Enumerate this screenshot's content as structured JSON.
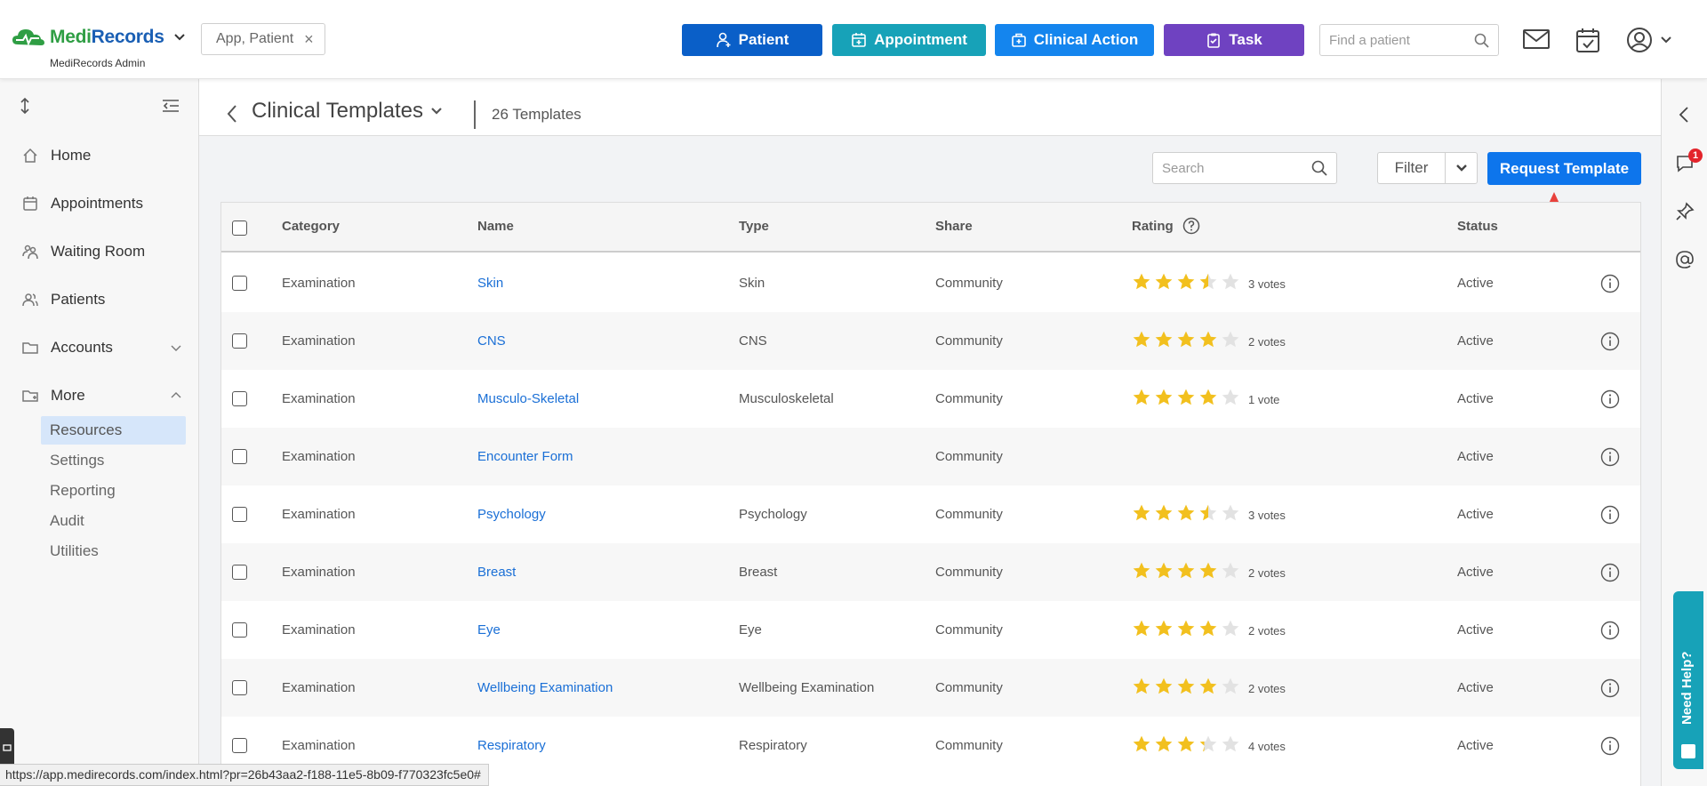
{
  "app": {
    "name_part1": "Medi",
    "name_part2": "Records",
    "subtitle": "MediRecords Admin",
    "context_chip": "App, Patient"
  },
  "header": {
    "buttons": {
      "patient": "Patient",
      "appointment": "Appointment",
      "clinical_action": "Clinical Action",
      "task": "Task"
    },
    "find_placeholder": "Find a patient"
  },
  "sidebar": {
    "items": [
      {
        "label": "Home"
      },
      {
        "label": "Appointments"
      },
      {
        "label": "Waiting Room"
      },
      {
        "label": "Patients"
      },
      {
        "label": "Accounts"
      },
      {
        "label": "More"
      }
    ],
    "sub_items": [
      {
        "label": "Resources"
      },
      {
        "label": "Settings"
      },
      {
        "label": "Reporting"
      },
      {
        "label": "Audit"
      },
      {
        "label": "Utilities"
      }
    ]
  },
  "page": {
    "title": "Clinical Templates",
    "count": "26 Templates",
    "search_placeholder": "Search",
    "filter_label": "Filter",
    "request_button": "Request Template"
  },
  "table": {
    "columns": {
      "category": "Category",
      "name": "Name",
      "type": "Type",
      "share": "Share",
      "rating": "Rating",
      "status": "Status"
    },
    "rows": [
      {
        "category": "Examination",
        "name": "Skin",
        "type": "Skin",
        "share": "Community",
        "rating": 3.5,
        "votes": "3 votes",
        "status": "Active"
      },
      {
        "category": "Examination",
        "name": "CNS",
        "type": "CNS",
        "share": "Community",
        "rating": 4,
        "votes": "2 votes",
        "status": "Active"
      },
      {
        "category": "Examination",
        "name": "Musculo-Skeletal",
        "type": "Musculoskeletal",
        "share": "Community",
        "rating": 4,
        "votes": "1 vote",
        "status": "Active"
      },
      {
        "category": "Examination",
        "name": "Encounter Form",
        "type": "",
        "share": "Community",
        "rating": null,
        "votes": "",
        "status": "Active"
      },
      {
        "category": "Examination",
        "name": "Psychology",
        "type": "Psychology",
        "share": "Community",
        "rating": 3.5,
        "votes": "3 votes",
        "status": "Active"
      },
      {
        "category": "Examination",
        "name": "Breast",
        "type": "Breast",
        "share": "Community",
        "rating": 4,
        "votes": "2 votes",
        "status": "Active"
      },
      {
        "category": "Examination",
        "name": "Eye",
        "type": "Eye",
        "share": "Community",
        "rating": 4,
        "votes": "2 votes",
        "status": "Active"
      },
      {
        "category": "Examination",
        "name": "Wellbeing Examination",
        "type": "Wellbeing Examination",
        "share": "Community",
        "rating": 4,
        "votes": "2 votes",
        "status": "Active"
      },
      {
        "category": "Examination",
        "name": "Respiratory",
        "type": "Respiratory",
        "share": "Community",
        "rating": 3.25,
        "votes": "4 votes",
        "status": "Active"
      }
    ]
  },
  "rail": {
    "notification_count": "1",
    "help_label": "Need Help?"
  },
  "statusbar": {
    "url": "https://app.medirecords.com/index.html?pr=26b43aa2-f188-11e5-8b09-f770323fc5e0#"
  },
  "colors": {
    "patient": "#0a5fc8",
    "appointment": "#17a2b8",
    "clinical_action": "#1485ee",
    "task": "#6f42c1",
    "link": "#1a6fd6",
    "star": "#f2c01e",
    "arrow": "#e8413c"
  },
  "icons": [
    "search-icon",
    "mail-icon",
    "calendar-icon",
    "user-icon",
    "home-icon",
    "star-icon",
    "info-icon",
    "chevron-down-icon",
    "collapse-icon",
    "pin-icon",
    "at-icon",
    "comment-icon"
  ]
}
